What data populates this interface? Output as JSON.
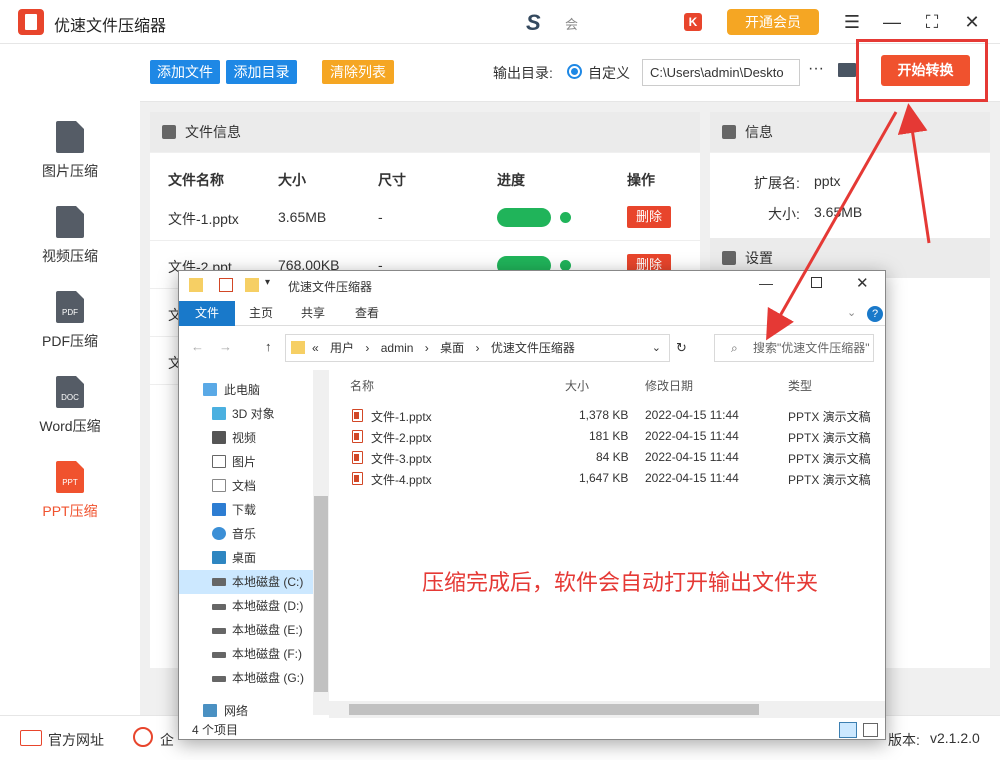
{
  "app": {
    "title": "优速文件压缩器",
    "brand_text": "会",
    "vip_label": "开通会员",
    "vip_icon": "K"
  },
  "window_controls": {
    "menu": "☰",
    "minimize": "—",
    "maximize": "⛶",
    "close": "✕"
  },
  "sidebar": {
    "items": [
      {
        "label": "图片压缩",
        "badge": ""
      },
      {
        "label": "视频压缩",
        "badge": ""
      },
      {
        "label": "PDF压缩",
        "badge": "PDF"
      },
      {
        "label": "Word压缩",
        "badge": "DOC"
      },
      {
        "label": "PPT压缩",
        "badge": "PPT",
        "active": true
      }
    ]
  },
  "toolbar": {
    "add_file": "添加文件",
    "add_dir": "添加目录",
    "clear_list": "清除列表",
    "output_label": "输出目录:",
    "radio_label": "自定义",
    "output_path": "C:\\Users\\admin\\Deskto",
    "more": "···",
    "start": "开始转换",
    "colors": {
      "blue": "#1e88e5",
      "orange": "#f5a623",
      "red": "#f0522e"
    }
  },
  "file_panel": {
    "header": "文件信息",
    "columns": [
      "文件名称",
      "大小",
      "尺寸",
      "进度",
      "操作"
    ],
    "rows": [
      {
        "name": "文件-1.pptx",
        "size": "3.65MB",
        "dim": "-",
        "action": "删除"
      },
      {
        "name": "文件-2.ppt",
        "size": "768.00KB",
        "dim": "-",
        "action": "删除"
      },
      {
        "name": "文",
        "size": "",
        "dim": "",
        "action": ""
      },
      {
        "name": "文",
        "size": "",
        "dim": "",
        "action": ""
      }
    ]
  },
  "info_panel": {
    "header": "信息",
    "ext_label": "扩展名:",
    "ext_value": "pptx",
    "size_label": "大小:",
    "size_value": "3.65MB",
    "settings_header": "设置"
  },
  "bottom": {
    "site": "官方网址",
    "item2": "企",
    "version_label": "版本:",
    "version": "v2.1.2.0"
  },
  "explorer": {
    "title": "优速文件压缩器",
    "ribbon": [
      "文件",
      "主页",
      "共享",
      "查看"
    ],
    "address": [
      "«",
      "用户",
      "›",
      "admin",
      "›",
      "桌面",
      "›",
      "优速文件压缩器"
    ],
    "search_placeholder": "搜索\"优速文件压缩器\"",
    "nav": [
      "此电脑",
      "3D 对象",
      "视频",
      "图片",
      "文档",
      "下载",
      "音乐",
      "桌面",
      "本地磁盘 (C:)",
      "本地磁盘 (D:)",
      "本地磁盘 (E:)",
      "本地磁盘 (F:)",
      "本地磁盘 (G:)",
      "网络"
    ],
    "columns": [
      "名称",
      "大小",
      "修改日期",
      "类型"
    ],
    "files": [
      {
        "name": "文件-1.pptx",
        "size": "1,378 KB",
        "date": "2022-04-15 11:44",
        "type": "PPTX 演示文稿"
      },
      {
        "name": "文件-2.pptx",
        "size": "181 KB",
        "date": "2022-04-15 11:44",
        "type": "PPTX 演示文稿"
      },
      {
        "name": "文件-3.pptx",
        "size": "84 KB",
        "date": "2022-04-15 11:44",
        "type": "PPTX 演示文稿"
      },
      {
        "name": "文件-4.pptx",
        "size": "1,647 KB",
        "date": "2022-04-15 11:44",
        "type": "PPTX 演示文稿"
      }
    ],
    "status": "4 个项目"
  },
  "annotation": "压缩完成后，软件会自动打开输出文件夹"
}
